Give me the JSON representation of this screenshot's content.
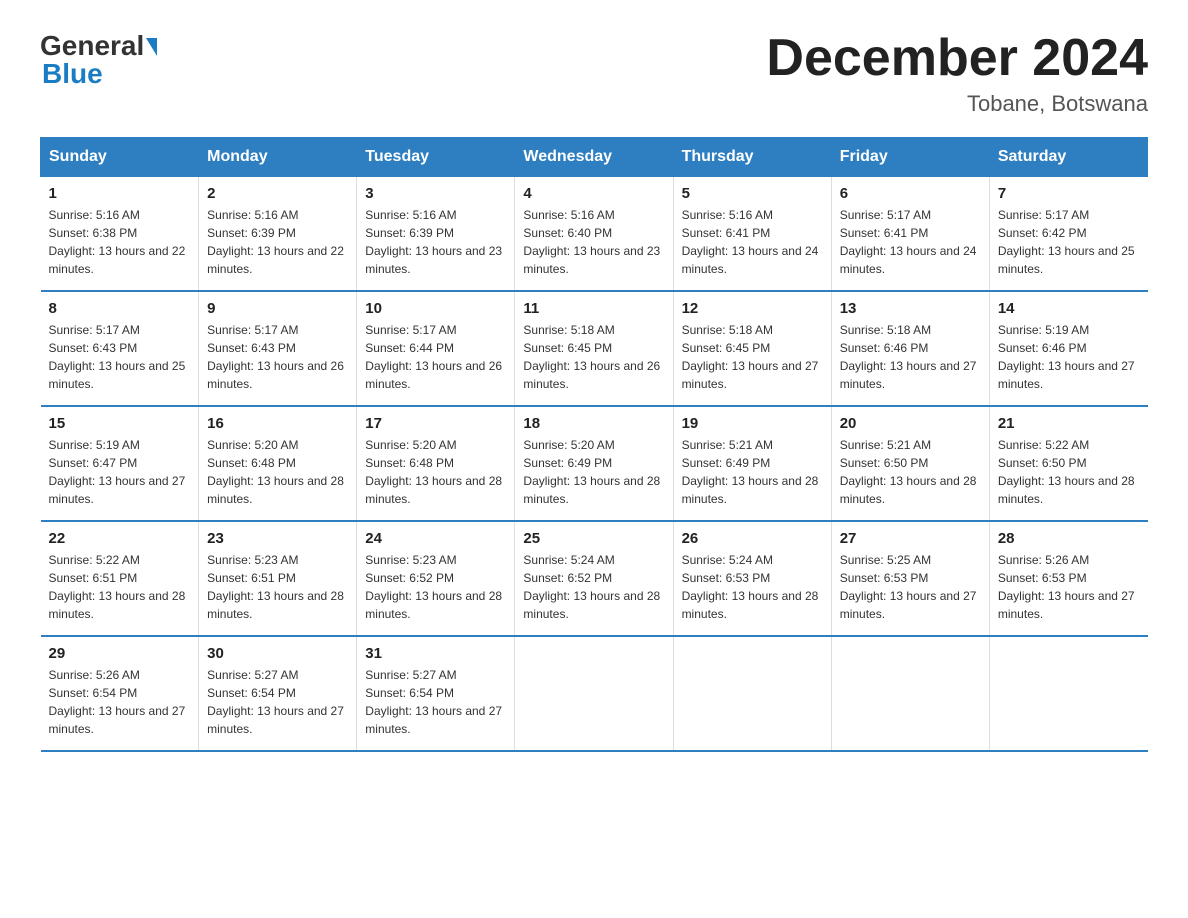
{
  "header": {
    "title": "December 2024",
    "subtitle": "Tobane, Botswana",
    "logo_general": "General",
    "logo_blue": "Blue"
  },
  "calendar": {
    "weekdays": [
      "Sunday",
      "Monday",
      "Tuesday",
      "Wednesday",
      "Thursday",
      "Friday",
      "Saturday"
    ],
    "weeks": [
      [
        {
          "day": "1",
          "sunrise": "5:16 AM",
          "sunset": "6:38 PM",
          "daylight": "13 hours and 22 minutes."
        },
        {
          "day": "2",
          "sunrise": "5:16 AM",
          "sunset": "6:39 PM",
          "daylight": "13 hours and 22 minutes."
        },
        {
          "day": "3",
          "sunrise": "5:16 AM",
          "sunset": "6:39 PM",
          "daylight": "13 hours and 23 minutes."
        },
        {
          "day": "4",
          "sunrise": "5:16 AM",
          "sunset": "6:40 PM",
          "daylight": "13 hours and 23 minutes."
        },
        {
          "day": "5",
          "sunrise": "5:16 AM",
          "sunset": "6:41 PM",
          "daylight": "13 hours and 24 minutes."
        },
        {
          "day": "6",
          "sunrise": "5:17 AM",
          "sunset": "6:41 PM",
          "daylight": "13 hours and 24 minutes."
        },
        {
          "day": "7",
          "sunrise": "5:17 AM",
          "sunset": "6:42 PM",
          "daylight": "13 hours and 25 minutes."
        }
      ],
      [
        {
          "day": "8",
          "sunrise": "5:17 AM",
          "sunset": "6:43 PM",
          "daylight": "13 hours and 25 minutes."
        },
        {
          "day": "9",
          "sunrise": "5:17 AM",
          "sunset": "6:43 PM",
          "daylight": "13 hours and 26 minutes."
        },
        {
          "day": "10",
          "sunrise": "5:17 AM",
          "sunset": "6:44 PM",
          "daylight": "13 hours and 26 minutes."
        },
        {
          "day": "11",
          "sunrise": "5:18 AM",
          "sunset": "6:45 PM",
          "daylight": "13 hours and 26 minutes."
        },
        {
          "day": "12",
          "sunrise": "5:18 AM",
          "sunset": "6:45 PM",
          "daylight": "13 hours and 27 minutes."
        },
        {
          "day": "13",
          "sunrise": "5:18 AM",
          "sunset": "6:46 PM",
          "daylight": "13 hours and 27 minutes."
        },
        {
          "day": "14",
          "sunrise": "5:19 AM",
          "sunset": "6:46 PM",
          "daylight": "13 hours and 27 minutes."
        }
      ],
      [
        {
          "day": "15",
          "sunrise": "5:19 AM",
          "sunset": "6:47 PM",
          "daylight": "13 hours and 27 minutes."
        },
        {
          "day": "16",
          "sunrise": "5:20 AM",
          "sunset": "6:48 PM",
          "daylight": "13 hours and 28 minutes."
        },
        {
          "day": "17",
          "sunrise": "5:20 AM",
          "sunset": "6:48 PM",
          "daylight": "13 hours and 28 minutes."
        },
        {
          "day": "18",
          "sunrise": "5:20 AM",
          "sunset": "6:49 PM",
          "daylight": "13 hours and 28 minutes."
        },
        {
          "day": "19",
          "sunrise": "5:21 AM",
          "sunset": "6:49 PM",
          "daylight": "13 hours and 28 minutes."
        },
        {
          "day": "20",
          "sunrise": "5:21 AM",
          "sunset": "6:50 PM",
          "daylight": "13 hours and 28 minutes."
        },
        {
          "day": "21",
          "sunrise": "5:22 AM",
          "sunset": "6:50 PM",
          "daylight": "13 hours and 28 minutes."
        }
      ],
      [
        {
          "day": "22",
          "sunrise": "5:22 AM",
          "sunset": "6:51 PM",
          "daylight": "13 hours and 28 minutes."
        },
        {
          "day": "23",
          "sunrise": "5:23 AM",
          "sunset": "6:51 PM",
          "daylight": "13 hours and 28 minutes."
        },
        {
          "day": "24",
          "sunrise": "5:23 AM",
          "sunset": "6:52 PM",
          "daylight": "13 hours and 28 minutes."
        },
        {
          "day": "25",
          "sunrise": "5:24 AM",
          "sunset": "6:52 PM",
          "daylight": "13 hours and 28 minutes."
        },
        {
          "day": "26",
          "sunrise": "5:24 AM",
          "sunset": "6:53 PM",
          "daylight": "13 hours and 28 minutes."
        },
        {
          "day": "27",
          "sunrise": "5:25 AM",
          "sunset": "6:53 PM",
          "daylight": "13 hours and 27 minutes."
        },
        {
          "day": "28",
          "sunrise": "5:26 AM",
          "sunset": "6:53 PM",
          "daylight": "13 hours and 27 minutes."
        }
      ],
      [
        {
          "day": "29",
          "sunrise": "5:26 AM",
          "sunset": "6:54 PM",
          "daylight": "13 hours and 27 minutes."
        },
        {
          "day": "30",
          "sunrise": "5:27 AM",
          "sunset": "6:54 PM",
          "daylight": "13 hours and 27 minutes."
        },
        {
          "day": "31",
          "sunrise": "5:27 AM",
          "sunset": "6:54 PM",
          "daylight": "13 hours and 27 minutes."
        },
        null,
        null,
        null,
        null
      ]
    ]
  }
}
